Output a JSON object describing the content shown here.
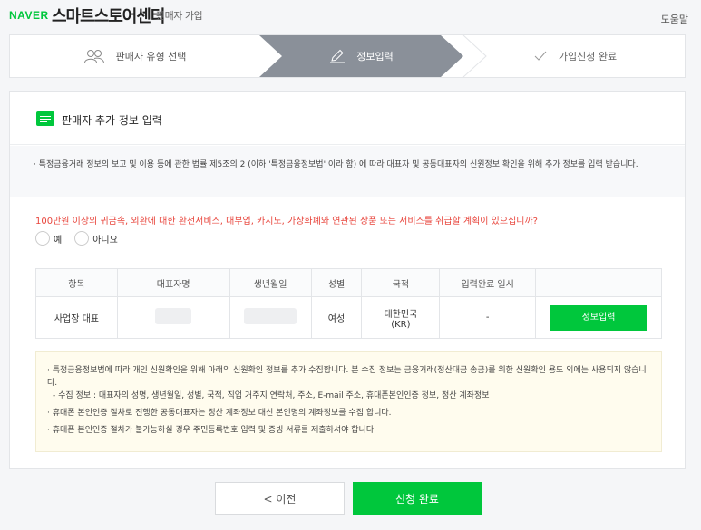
{
  "header": {
    "brand": "NAVER",
    "title": "스마트스토어센터",
    "subtitle": "판매자 가입",
    "help": "도움말"
  },
  "steps": [
    {
      "label": "판매자 유형 선택",
      "icon": "people-icon",
      "state": "done"
    },
    {
      "label": "정보입력",
      "icon": "pencil-icon",
      "state": "active"
    },
    {
      "label": "가입신청 완료",
      "icon": "check-icon",
      "state": "pending"
    }
  ],
  "section": {
    "title": "판매자 추가 정보 입력",
    "icon": "id-card-icon",
    "notice": "· 특정금융거래 정보의 보고 및 이용 등에 관한 법률 제5조의 2 (이하 '특정금융정보법' 이라 함) 에 따라 대표자 및 공동대표자의 신원정보 확인을 위해 추가 정보를 입력 받습니다."
  },
  "question": {
    "text": "100만원 이상의 귀금속, 외환에 대한 환전서비스, 대부업, 카지노, 가상화폐와 연관된 상품 또는 서비스를 취급할 계획이 있으십니까?",
    "yes": "예",
    "no": "아니요"
  },
  "table": {
    "headers": [
      "항목",
      "대표자명",
      "생년월일",
      "성별",
      "국적",
      "입력완료 일시",
      ""
    ],
    "row": {
      "item": "사업장 대표",
      "name": "",
      "birth": "",
      "gender": "여성",
      "nationality_line1": "대한민국",
      "nationality_line2": "(KR)",
      "completed_at": "-",
      "action": "정보입력"
    }
  },
  "notes": {
    "line1": "· 특정금융정보법에 따라 개인 신원확인을 위해 아래의 신원확인 정보를 추가 수집합니다. 본 수집 정보는 금융거래(정산대금 송금)를 위한 신원확인 용도 외에는 사용되지 않습니다.",
    "line1_sub": "- 수집 정보 : 대표자의 성명, 생년월일, 성별, 국적, 직업 거주지 연락처, 주소, E-mail 주소, 휴대폰본인인증 정보, 정산 계좌정보",
    "line2": "· 휴대폰 본인인증 절차로 진행한 공동대표자는 정산 계좌정보 대신 본인명의 계좌정보를 수집 합니다.",
    "line3": "· 휴대폰 본인인증 절차가 불가능하실 경우 주민등록번호 입력 및 증빙 서류를 제출하셔야 합니다."
  },
  "buttons": {
    "prev": "< 이전",
    "submit": "신청 완료"
  },
  "colors": {
    "accent": "#00c73c",
    "warning": "#e8453c",
    "step_active": "#8a9099"
  }
}
